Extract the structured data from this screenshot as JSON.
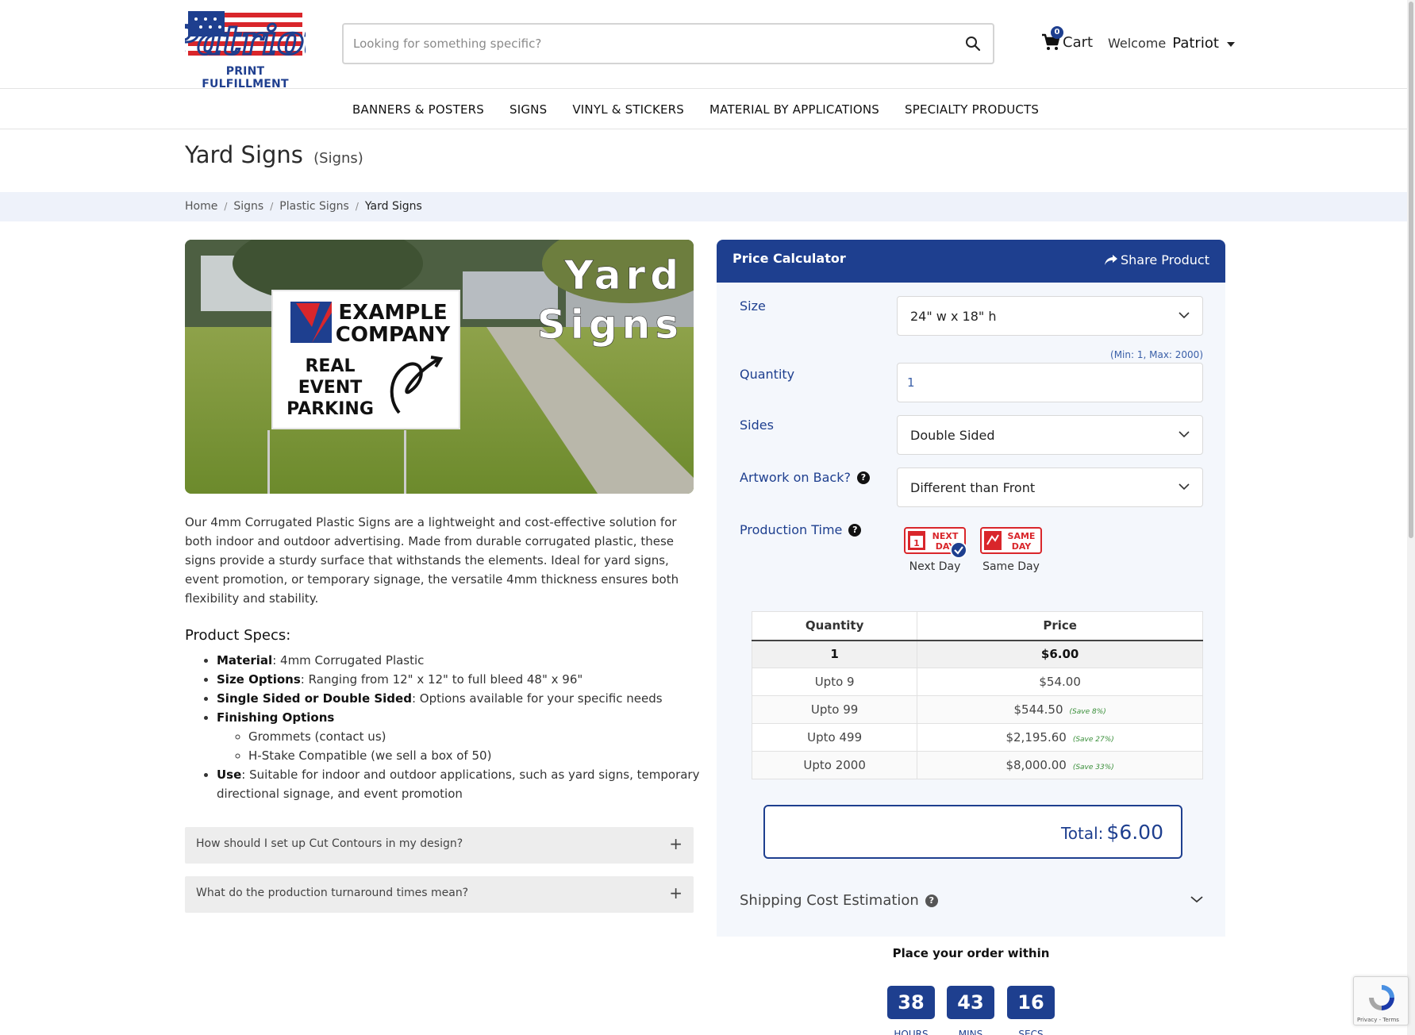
{
  "header": {
    "logo_word": "Patriot",
    "logo_sub": "PRINT FULFILLMENT",
    "search_placeholder": "Looking for something specific?",
    "cart_count": "0",
    "cart_label": "Cart",
    "welcome_label": "Welcome",
    "user_name": "Patriot"
  },
  "nav": [
    "BANNERS & POSTERS",
    "SIGNS",
    "VINYL & STICKERS",
    "MATERIAL BY APPLICATIONS",
    "SPECIALTY PRODUCTS"
  ],
  "page": {
    "title": "Yard Signs",
    "category": "(Signs)"
  },
  "breadcrumb": [
    "Home",
    "Signs",
    "Plastic Signs",
    "Yard Signs"
  ],
  "image": {
    "headline_1": "Yard",
    "headline_2": "Signs",
    "sign_brand_1": "EXAMPLE",
    "sign_brand_2": "COMPANY",
    "sign_line_1": "REAL",
    "sign_line_2": "EVENT",
    "sign_line_3": "PARKING"
  },
  "description": "Our 4mm Corrugated Plastic Signs are a lightweight and cost-effective solution for both indoor and outdoor advertising. Made from durable corrugated plastic, these signs provide a sturdy surface that withstands the elements. Ideal for yard signs, event promotion, or temporary signage, the versatile 4mm thickness ensures both flexibility and stability.",
  "specs": {
    "title": "Product Specs:",
    "material_label": "Material",
    "material_value": ": 4mm Corrugated Plastic",
    "size_label": "Size Options",
    "size_value": ": Ranging from 12\" x 12\" to full bleed 48\" x 96\"",
    "sides_label": "Single Sided or Double Sided",
    "sides_value": ": Options available for your specific needs",
    "finishing_label": "Finishing Options",
    "finishing_items": [
      "Grommets (contact us)",
      "H-Stake Compatible (we sell a box of 50)"
    ],
    "use_label": "Use",
    "use_value": ": Suitable for indoor and outdoor applications, such as yard signs, temporary directional signage, and event promotion"
  },
  "faq": [
    "How should I set up Cut Contours in my design?",
    "What do the production turnaround times mean?"
  ],
  "calculator": {
    "title": "Price Calculator",
    "share_label": "Share Product",
    "size_label": "Size",
    "size_value": "24\" w x 18\" h",
    "quantity_hint": "(Min: 1, Max: 2000)",
    "quantity_label": "Quantity",
    "quantity_value": "1",
    "sides_label": "Sides",
    "sides_value": "Double Sided",
    "artwork_label": "Artwork on Back?",
    "artwork_value": "Different than Front",
    "production_label": "Production Time",
    "production_options": [
      {
        "badge_1": "NEXT",
        "badge_2": "DAY",
        "label": "Next Day",
        "selected": true
      },
      {
        "badge_1": "SAME",
        "badge_2": "DAY",
        "label": "Same Day",
        "selected": false
      }
    ],
    "table_headers": [
      "Quantity",
      "Price"
    ],
    "tiers": [
      {
        "qty": "1",
        "price": "$6.00",
        "save": ""
      },
      {
        "qty": "Upto 9",
        "price": "$54.00",
        "save": ""
      },
      {
        "qty": "Upto 99",
        "price": "$544.50",
        "save": "(Save 8%)"
      },
      {
        "qty": "Upto 499",
        "price": "$2,195.60",
        "save": "(Save 27%)"
      },
      {
        "qty": "Upto 2000",
        "price": "$8,000.00",
        "save": "(Save 33%)"
      }
    ],
    "total_label": "Total:",
    "total_value": "$6.00",
    "shipping_label": "Shipping Cost Estimation",
    "order_within": "Place your order within",
    "countdown": {
      "hours": "38",
      "mins": "43",
      "secs": "16",
      "hours_label": "HOURS",
      "mins_label": "MINS",
      "secs_label": "SECS"
    }
  },
  "recaptcha_text": "Privacy - Terms",
  "colors": {
    "brand_blue": "#1e3f8f",
    "flag_red": "#d9262b",
    "breadcrumb_bg": "#eef2fa"
  }
}
